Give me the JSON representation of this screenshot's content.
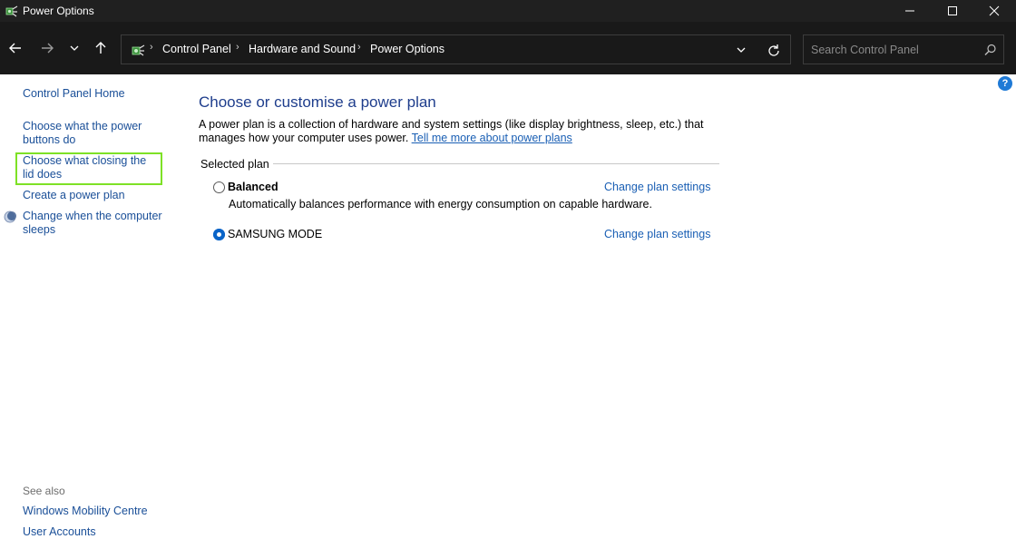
{
  "window": {
    "title": "Power Options",
    "minimize_glyph": "—",
    "maximize_glyph": "☐",
    "close_glyph": "✕"
  },
  "navbar": {
    "breadcrumbs": [
      "Control Panel",
      "Hardware and Sound",
      "Power Options"
    ],
    "breadcrumb_separator": "›",
    "search_placeholder": "Search Control Panel"
  },
  "left_pane": {
    "home": "Control Panel Home",
    "links": [
      "Choose what the power buttons do",
      "Choose what closing the lid does",
      "Create a power plan",
      "Change when the computer sleeps"
    ],
    "see_also_label": "See also",
    "see_also": [
      "Windows Mobility Centre",
      "User Accounts"
    ]
  },
  "main": {
    "heading": "Choose or customise a power plan",
    "description": "A power plan is a collection of hardware and system settings (like display brightness, sleep, etc.) that manages how your computer uses power.",
    "learn_more": "Tell me more about power plans",
    "group_label": "Selected plan",
    "plans": [
      {
        "name": "Balanced",
        "description": "Automatically balances performance with energy consumption on capable hardware.",
        "selected": false,
        "change_link": "Change plan settings"
      },
      {
        "name": "SAMSUNG MODE",
        "description": "",
        "selected": true,
        "change_link": "Change plan settings"
      }
    ],
    "help_glyph": "?"
  },
  "colors": {
    "titlebar_bg": "#202020",
    "navbar_bg": "#191919",
    "link": "#1a4f98",
    "heading": "#1e3d8c",
    "highlight_border": "#7ee126",
    "radio_selected": "#0a64c8"
  },
  "icons": [
    "power-options-icon",
    "back-arrow-icon",
    "forward-arrow-icon",
    "chevron-down-icon",
    "up-arrow-icon",
    "control-panel-icon",
    "refresh-icon",
    "search-icon",
    "moon-icon",
    "help-icon"
  ]
}
